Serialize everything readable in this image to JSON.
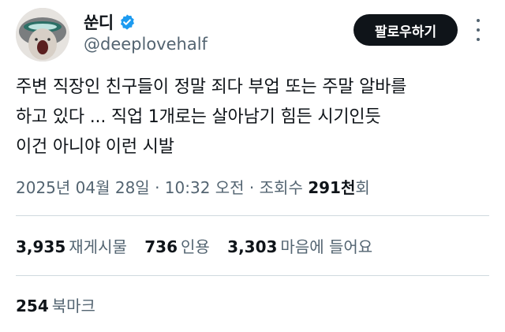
{
  "author": {
    "display_name": "쑨디",
    "handle": "@deeplovehalf",
    "verified": true,
    "verified_color": "#1d9bf0"
  },
  "actions": {
    "follow_label": "팔로우하기",
    "more_icon": "more-vertical-icon"
  },
  "tweet": {
    "lines": [
      "주변 직장인 친구들이 정말 죄다 부업 또는 주말 알바를",
      "하고 있다 ... 직업 1개로는 살아남기 힘든 시기인듯",
      "이건 아니야 이런 시발"
    ]
  },
  "meta": {
    "datetime": "2025년 04월 28일 · 10:32 오전 · 조회수 ",
    "views_count": "291천",
    "views_suffix": "회"
  },
  "stats": {
    "retweets": {
      "count": "3,935",
      "label": "재게시물"
    },
    "quotes": {
      "count": "736",
      "label": "인용"
    },
    "likes": {
      "count": "3,303",
      "label": "마음에 들어요"
    }
  },
  "bookmarks": {
    "count": "254",
    "label": "북마크"
  }
}
